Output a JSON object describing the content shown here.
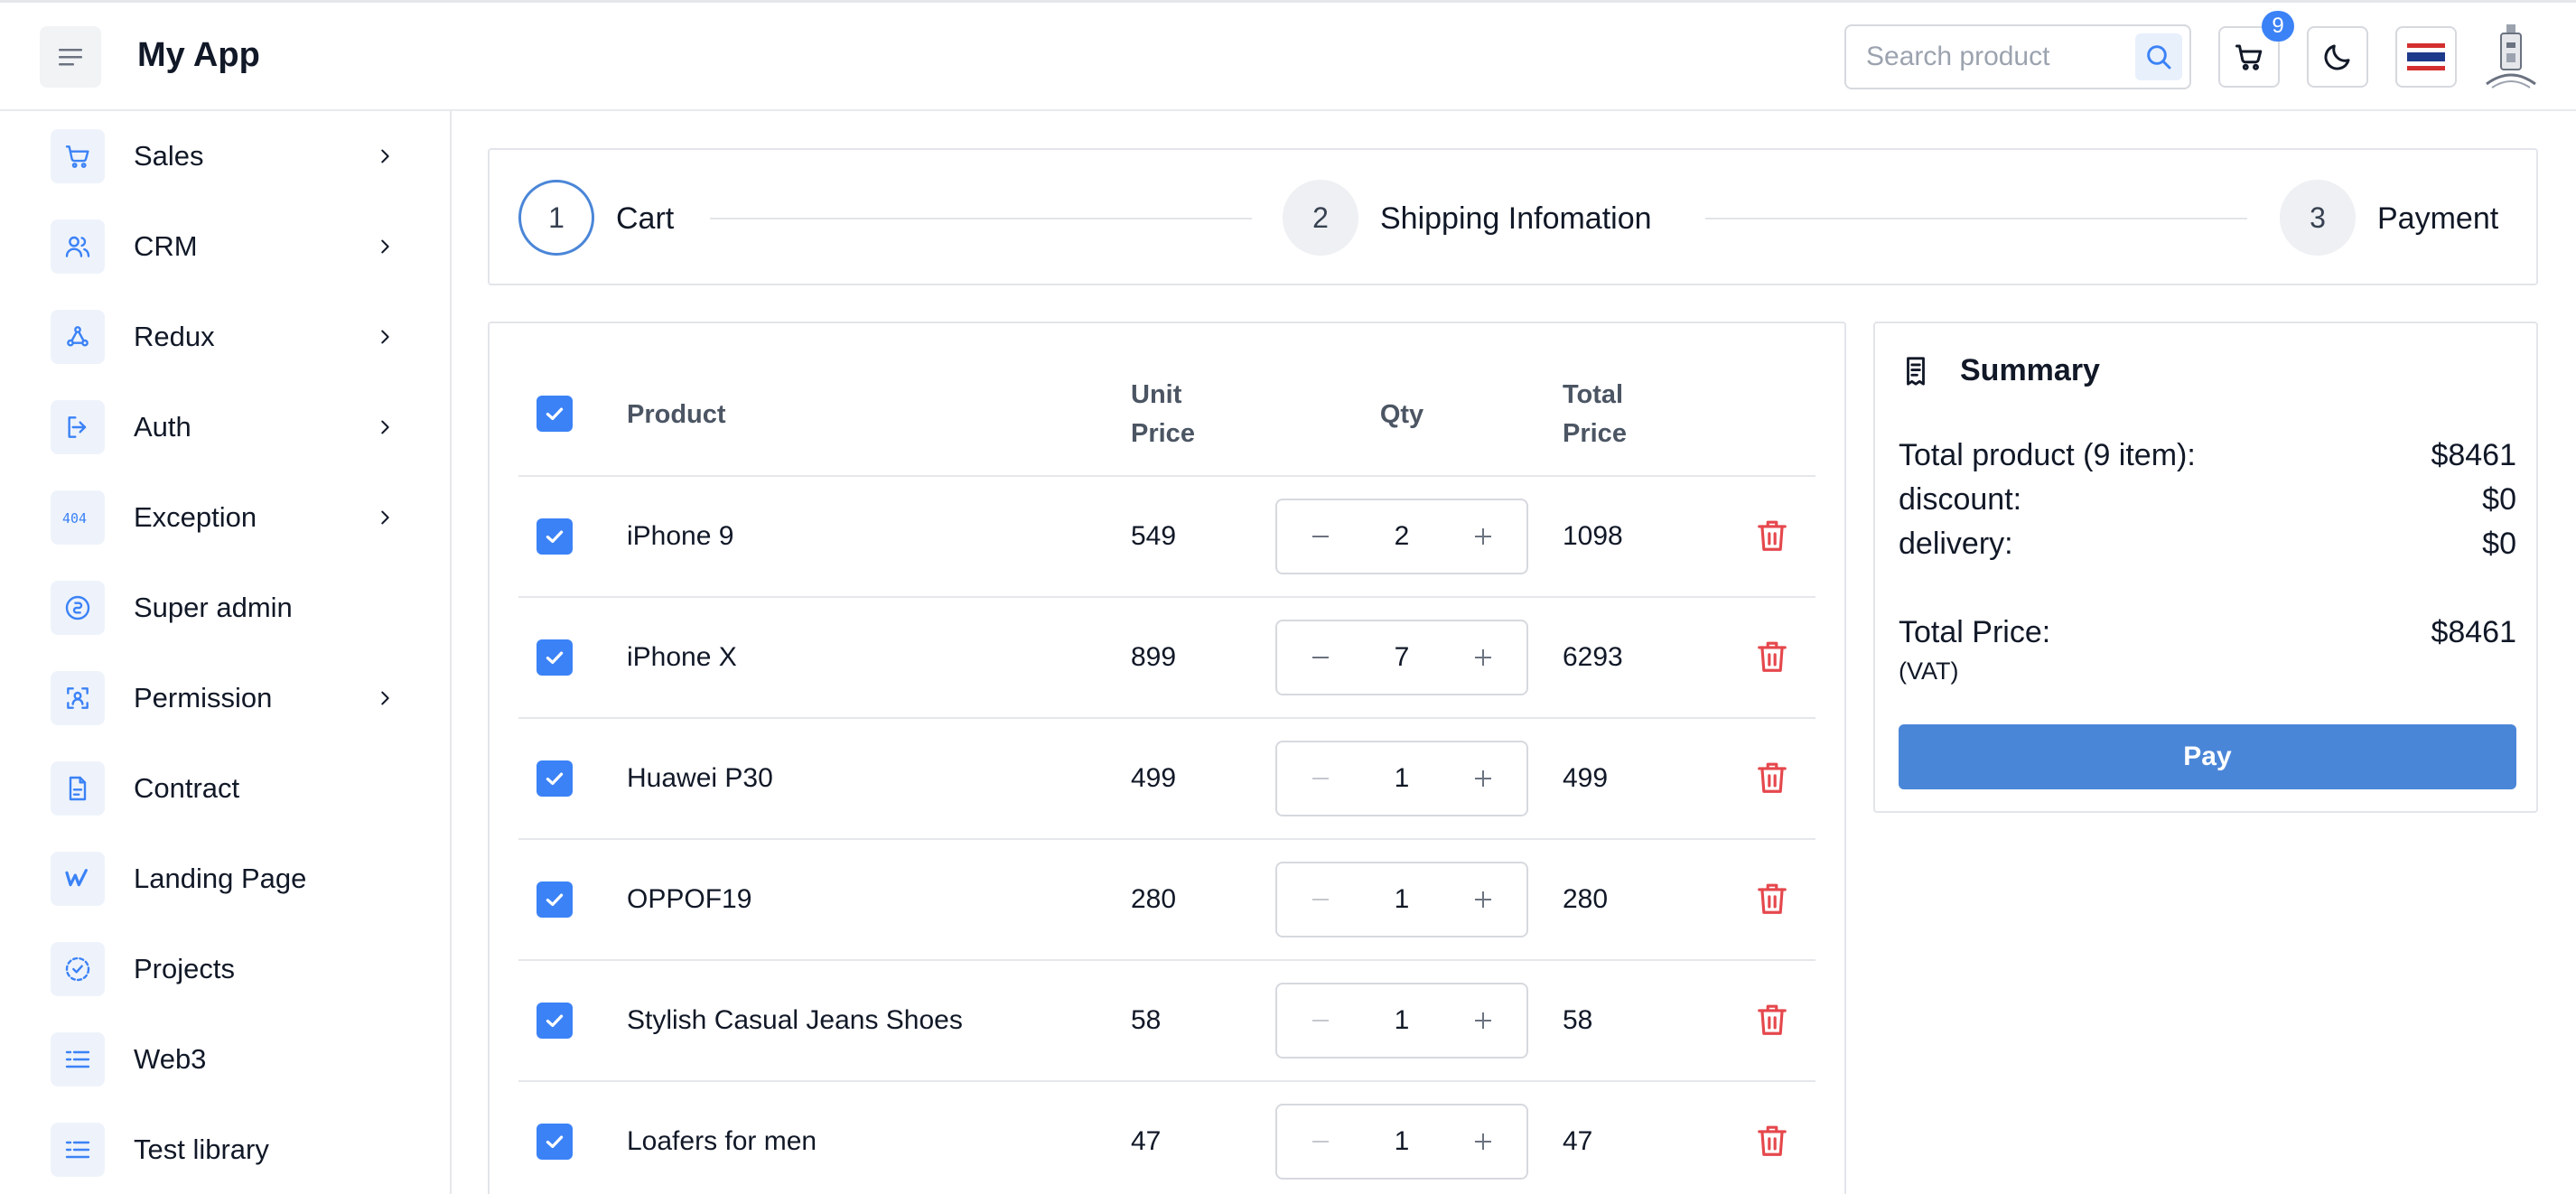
{
  "header": {
    "app_title": "My App",
    "search_placeholder": "Search product",
    "cart_badge": "9",
    "icons": {
      "menu": "hamburger-icon",
      "search": "search-icon",
      "cart": "cart-icon",
      "theme": "moon-icon",
      "language": "thai-flag-icon",
      "avatar": "avatar-image"
    }
  },
  "sidebar": {
    "items": [
      {
        "label": "Sales",
        "icon": "cart-icon",
        "has_children": true
      },
      {
        "label": "CRM",
        "icon": "users-icon",
        "has_children": true
      },
      {
        "label": "Redux",
        "icon": "redux-icon",
        "has_children": true
      },
      {
        "label": "Auth",
        "icon": "login-icon",
        "has_children": true
      },
      {
        "label": "Exception",
        "icon": "404-icon",
        "has_children": true
      },
      {
        "label": "Super admin",
        "icon": "super-admin-icon",
        "has_children": false
      },
      {
        "label": "Permission",
        "icon": "permission-icon",
        "has_children": true
      },
      {
        "label": "Contract",
        "icon": "document-icon",
        "has_children": false
      },
      {
        "label": "Landing Page",
        "icon": "webflow-icon",
        "has_children": false
      },
      {
        "label": "Projects",
        "icon": "dashed-check-icon",
        "has_children": false
      },
      {
        "label": "Web3",
        "icon": "list-icon",
        "has_children": false
      },
      {
        "label": "Test library",
        "icon": "list-icon",
        "has_children": false
      }
    ]
  },
  "stepper": {
    "steps": [
      {
        "number": "1",
        "label": "Cart",
        "active": true
      },
      {
        "number": "2",
        "label": "Shipping Infomation",
        "active": false
      },
      {
        "number": "3",
        "label": "Payment",
        "active": false
      }
    ]
  },
  "cart": {
    "headers": {
      "product": "Product",
      "unit_price_1": "Unit",
      "unit_price_2": "Price",
      "qty": "Qty",
      "total_price_1": "Total",
      "total_price_2": "Price"
    },
    "rows": [
      {
        "product": "iPhone 9",
        "unit_price": "549",
        "qty": "2",
        "total": "1098",
        "checked": true
      },
      {
        "product": "iPhone X",
        "unit_price": "899",
        "qty": "7",
        "total": "6293",
        "checked": true
      },
      {
        "product": "Huawei P30",
        "unit_price": "499",
        "qty": "1",
        "total": "499",
        "checked": true
      },
      {
        "product": "OPPOF19",
        "unit_price": "280",
        "qty": "1",
        "total": "280",
        "checked": true
      },
      {
        "product": "Stylish Casual Jeans Shoes",
        "unit_price": "58",
        "qty": "1",
        "total": "58",
        "checked": true
      },
      {
        "product": "Loafers for men",
        "unit_price": "47",
        "qty": "1",
        "total": "47",
        "checked": true
      }
    ]
  },
  "summary": {
    "title": "Summary",
    "total_product_label": "Total product (9 item):",
    "total_product_value": "$8461",
    "discount_label": "discount:",
    "discount_value": "$0",
    "delivery_label": "delivery:",
    "delivery_value": "$0",
    "total_price_label": "Total Price:",
    "total_price_value": "$8461",
    "vat_label": "(VAT)",
    "pay_label": "Pay"
  },
  "colors": {
    "accent": "#3b82f6",
    "button": "#4a86d8",
    "danger": "#e5484d",
    "icon_bg": "#eef3fb"
  }
}
